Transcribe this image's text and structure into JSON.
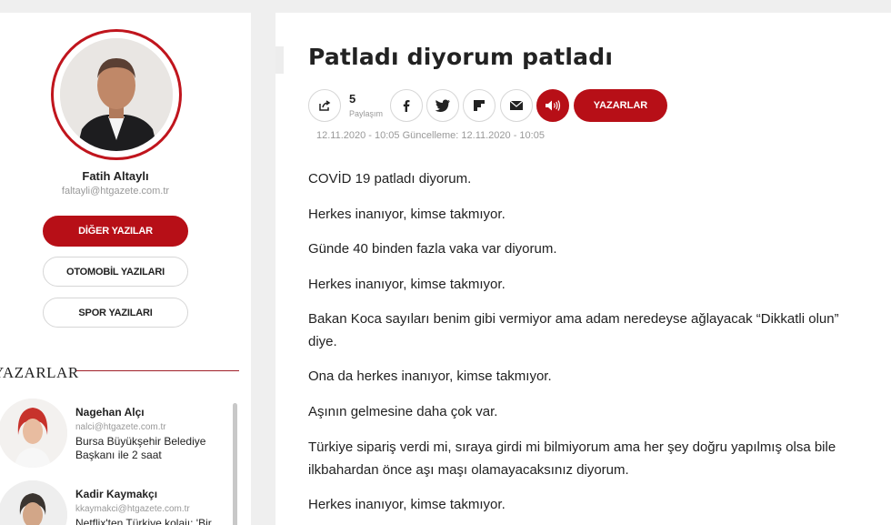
{
  "sidebar": {
    "author_name": "Fatih Altaylı",
    "author_email": "faltayli@htgazete.com.tr",
    "buttons": [
      "DİĞER YAZILAR",
      "OTOMOBİL YAZILARI",
      "SPOR YAZILARI"
    ],
    "section_title": "YAZARLAR",
    "writers": [
      {
        "name": "Nagehan Alçı",
        "email": "nalci@htgazete.com.tr",
        "text": "Bursa Büyükşehir Belediye Başkanı ile 2 saat"
      },
      {
        "name": "Kadir Kaymakçı",
        "email": "kkaymakci@htgazete.com.tr",
        "text": "Netflix'ten Türkiye kolajı: 'Bir"
      }
    ]
  },
  "article": {
    "title": "Patladı diyorum patladı",
    "share_count": "5",
    "share_label": "Paylaşım",
    "writers_button": "YAZARLAR",
    "dates": "12.11.2020 - 10:05 Güncelleme: 12.11.2020 - 10:05",
    "paragraphs": [
      "COVİD 19 patladı diyorum.",
      "Herkes inanıyor, kimse takmıyor.",
      "Günde 40 binden fazla vaka var diyorum.",
      "Herkes inanıyor, kimse takmıyor.",
      "Bakan Koca sayıları benim gibi vermiyor ama adam neredeyse ağlayacak “Dikkatli olun” diye.",
      "Ona da herkes inanıyor, kimse takmıyor.",
      "Aşının gelmesine daha çok var.",
      "Türkiye sipariş verdi mi, sıraya girdi mi bilmiyorum ama her şey doğru yapılmış olsa bile ilkbahardan önce aşı maşı olamayacaksınız diyorum.",
      "Herkes inanıyor, kimse takmıyor."
    ]
  },
  "icons": [
    "share-icon",
    "facebook-icon",
    "twitter-icon",
    "flipboard-icon",
    "email-icon",
    "speaker-icon"
  ],
  "colors": {
    "accent": "#b70f17",
    "background": "#efefef"
  }
}
